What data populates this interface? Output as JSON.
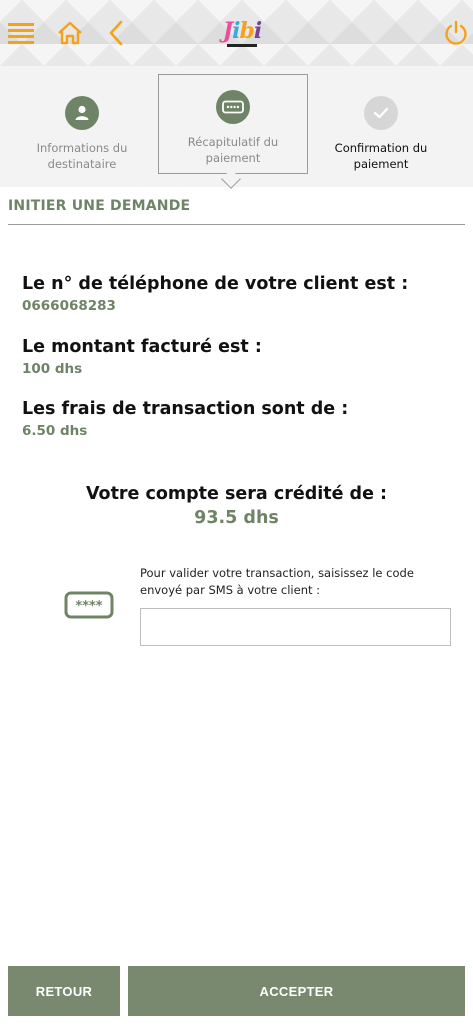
{
  "header": {
    "logo_text": "Jibi",
    "icons": [
      "menu-icon",
      "home-icon",
      "back-icon",
      "power-icon"
    ],
    "accent_color": "#f4a21c"
  },
  "stepper": {
    "steps": [
      {
        "label": "Informations du destinataire",
        "icon": "user-icon",
        "state": "done"
      },
      {
        "label": "Récapitulatif du paiement",
        "icon": "password-icon",
        "state": "active"
      },
      {
        "label": "Confirmation du paiement",
        "icon": "check-icon",
        "state": "pending"
      }
    ]
  },
  "section": {
    "title": "INITIER UNE DEMANDE"
  },
  "details": {
    "phone_label": "Le n° de téléphone de votre client est :",
    "phone_value": "0666068283",
    "amount_label": "Le montant facturé est :",
    "amount_value": "100 dhs",
    "fees_label": "Les frais de transaction sont de :",
    "fees_value": "6.50 dhs"
  },
  "credit": {
    "label": "Votre compte sera crédité de :",
    "value": "93.5 dhs"
  },
  "code": {
    "instruction": "Pour valider votre transaction, saisissez le code envoyé par SMS à votre client :",
    "value": "",
    "placeholder": ""
  },
  "buttons": {
    "back_label": "RETOUR",
    "accept_label": "ACCEPTER"
  },
  "colors": {
    "primary_green": "#6f8467",
    "button_green": "#78896f",
    "accent_orange": "#f4a21c"
  }
}
